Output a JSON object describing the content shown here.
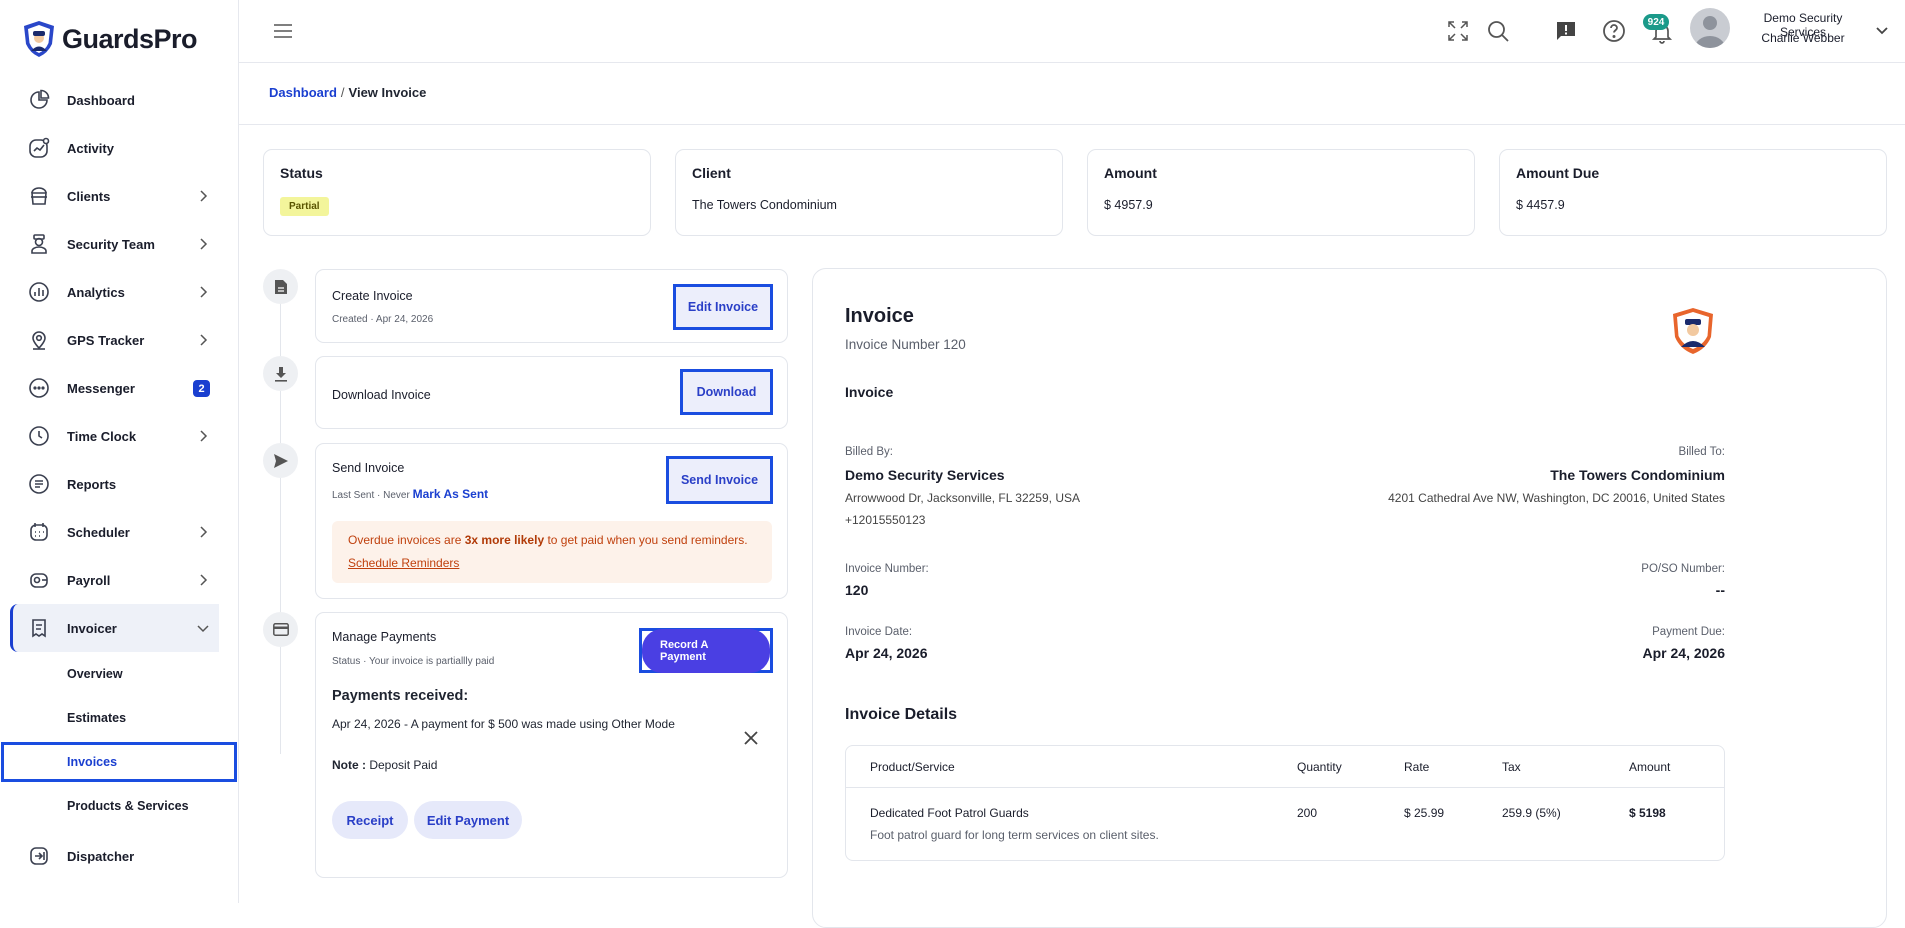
{
  "app": {
    "name": "GuardsPro"
  },
  "colors": {
    "accent": "#1a3fd0",
    "solid_button": "#4a3fe3",
    "status_pill": "#f3f59b",
    "alert_bg": "#fdf2ea",
    "notif_badge": "#1b9a8a"
  },
  "sidebar": {
    "items": [
      {
        "label": "Dashboard",
        "icon": "dashboard-icon"
      },
      {
        "label": "Activity",
        "icon": "activity-icon"
      },
      {
        "label": "Clients",
        "icon": "clients-icon"
      },
      {
        "label": "Security Team",
        "icon": "security-team-icon"
      },
      {
        "label": "Analytics",
        "icon": "analytics-icon"
      },
      {
        "label": "GPS Tracker",
        "icon": "gps-icon"
      },
      {
        "label": "Messenger",
        "icon": "messenger-icon",
        "badge": "2"
      },
      {
        "label": "Time Clock",
        "icon": "clock-icon"
      },
      {
        "label": "Reports",
        "icon": "reports-icon"
      },
      {
        "label": "Scheduler",
        "icon": "calendar-icon"
      },
      {
        "label": "Payroll",
        "icon": "wallet-icon"
      },
      {
        "label": "Invoicer",
        "icon": "invoice-icon"
      },
      {
        "label": "Dispatcher",
        "icon": "dispatcher-icon"
      }
    ],
    "sub_items": [
      "Overview",
      "Estimates",
      "Invoices",
      "Products & Services"
    ]
  },
  "topbar": {
    "notification_count": "924",
    "company": "Demo Security Services",
    "user": "Charlie Webber"
  },
  "breadcrumb": {
    "home": "Dashboard",
    "separator": "/",
    "current": "View Invoice"
  },
  "summary": {
    "status_label": "Status",
    "status_value": "Partial",
    "client_label": "Client",
    "client_value": "The Towers Condominium",
    "amount_label": "Amount",
    "amount_value": "$ 4957.9",
    "due_label": "Amount Due",
    "due_value": "$ 4457.9"
  },
  "steps": {
    "create": {
      "title": "Create Invoice",
      "meta": "Created · Apr 24, 2026",
      "button": "Edit Invoice"
    },
    "download": {
      "title": "Download Invoice",
      "button": "Download"
    },
    "send": {
      "title": "Send Invoice",
      "meta": "Last Sent · Never",
      "mark": "Mark As Sent",
      "button": "Send Invoice",
      "alert_pre": "Overdue invoices are ",
      "alert_bold": "3x more likely",
      "alert_post": " to get paid when you send reminders.",
      "alert_link": "Schedule Reminders"
    },
    "payments": {
      "title": "Manage Payments",
      "meta": "Status · Your invoice is partiallly paid",
      "button": "Record A Payment",
      "received_heading": "Payments received:",
      "payment_line": "Apr 24, 2026 - A payment for $ 500 was made using Other Mode",
      "note_label": "Note :",
      "note_value": "Deposit Paid",
      "receipt": "Receipt",
      "edit_payment": "Edit Payment"
    }
  },
  "invoice": {
    "title": "Invoice",
    "number_line": "Invoice Number 120",
    "subtitle": "Invoice",
    "billed_by_label": "Billed By:",
    "billed_by_name": "Demo Security Services",
    "billed_by_address": "Arrowwood Dr, Jacksonville, FL 32259, USA",
    "billed_by_phone": "+12015550123",
    "billed_to_label": "Billed To:",
    "billed_to_name": "The Towers Condominium",
    "billed_to_address": "4201 Cathedral Ave NW, Washington, DC 20016, United States",
    "number_label": "Invoice Number:",
    "number_value": "120",
    "po_label": "PO/SO Number:",
    "po_value": "--",
    "date_label": "Invoice Date:",
    "date_value": "Apr 24, 2026",
    "due_label": "Payment Due:",
    "due_value": "Apr 24, 2026",
    "details_heading": "Invoice Details",
    "columns": [
      "Product/Service",
      "Quantity",
      "Rate",
      "Tax",
      "Amount"
    ],
    "rows": [
      {
        "product": "Dedicated Foot Patrol Guards",
        "description": "Foot patrol guard for long term services on client sites.",
        "quantity": "200",
        "rate": "$ 25.99",
        "tax": "259.9 (5%)",
        "amount": "$ 5198"
      }
    ]
  }
}
